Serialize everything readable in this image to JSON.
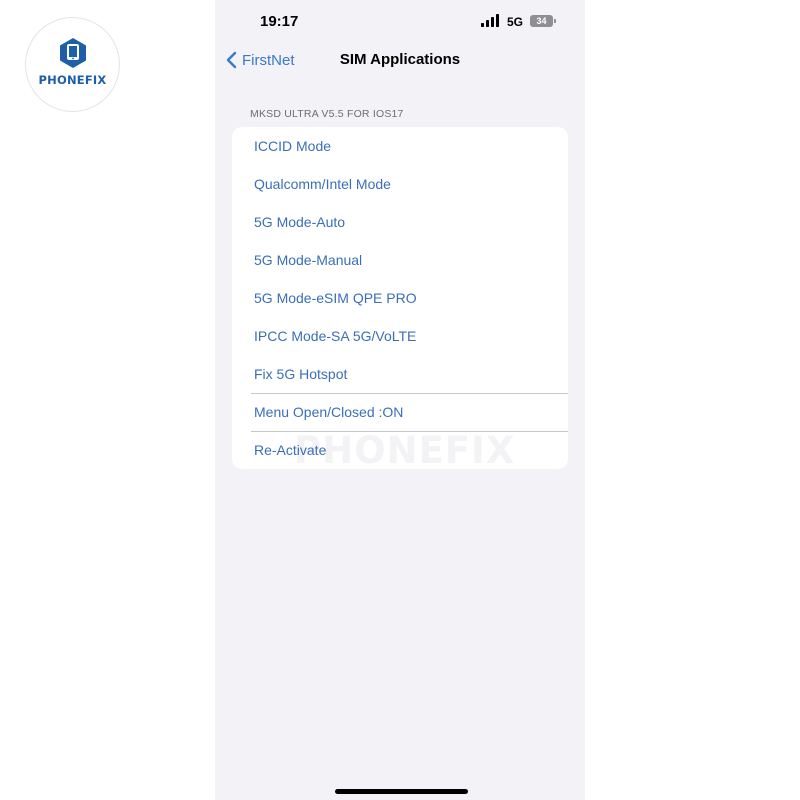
{
  "watermark": {
    "logo_text": "PHONEFIX",
    "overlay_text": "PHONEFIX",
    "brand_color": "#1f5fa8"
  },
  "status_bar": {
    "time": "19:17",
    "network": "5G",
    "battery": "34",
    "signal_icon": "cellular-signal-icon",
    "battery_icon": "battery-icon"
  },
  "nav": {
    "back_label": "FirstNet",
    "back_icon": "chevron-left-icon",
    "title": "SIM Applications"
  },
  "section": {
    "header": "MKSD ULTRA V5.5 FOR IOS17"
  },
  "menu": {
    "items": [
      {
        "label": "ICCID Mode"
      },
      {
        "label": "Qualcomm/Intel Mode"
      },
      {
        "label": "5G Mode-Auto"
      },
      {
        "label": "5G Mode-Manual"
      },
      {
        "label": "5G Mode-eSIM QPE PRO"
      },
      {
        "label": "IPCC Mode-SA 5G/VoLTE"
      },
      {
        "label": "Fix 5G Hotspot"
      },
      {
        "label": "Menu Open/Closed :ON"
      },
      {
        "label": "Re-Activate"
      }
    ]
  },
  "colors": {
    "accent": "#3a78c9",
    "background": "#f2f2f7",
    "list_bg": "#ffffff",
    "separator": "#c6c6c8"
  }
}
